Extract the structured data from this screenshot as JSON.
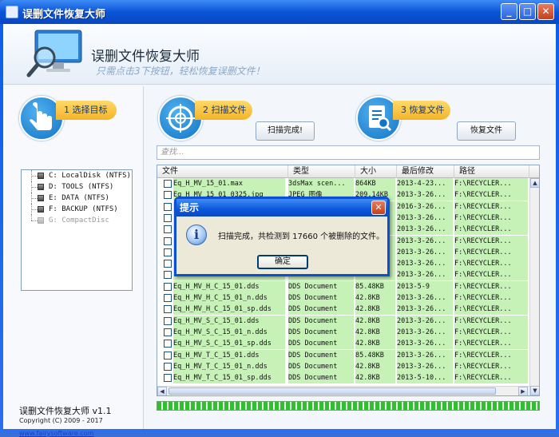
{
  "window": {
    "title": "误删文件恢复大师"
  },
  "header": {
    "app_name": "误删文件恢复大师",
    "slogan": "只需点击3下按钮，轻松恢复误删文件！"
  },
  "steps": {
    "step1": "1 选择目标",
    "step2": "2 扫描文件",
    "step3": "3 恢复文件",
    "scan_button": "扫描完成!",
    "recover_button": "恢复文件"
  },
  "drives": [
    {
      "label": "C: LocalDisk (NTFS)",
      "enabled": true
    },
    {
      "label": "D: TOOLS (NTFS)",
      "enabled": true
    },
    {
      "label": "E: DATA (NTFS)",
      "enabled": true
    },
    {
      "label": "F: BACKUP (NTFS)",
      "enabled": true
    },
    {
      "label": "G: CompactDisc",
      "enabled": false
    }
  ],
  "footer": {
    "version": "误删文件恢复大师 v1.1",
    "copyright": "Copyright (C) 2009 - 2017",
    "website": "www.fairysoftware.com"
  },
  "search": {
    "placeholder": "查找..."
  },
  "table": {
    "columns": [
      "文件",
      "类型",
      "大小",
      "最后修改",
      "路径"
    ],
    "rows": [
      [
        "Eq_H_MV_15_01.max",
        "3dsMax scen...",
        "864KB",
        "2013-4-23...",
        "F:\\RECYCLER..."
      ],
      [
        "Eq_H_MV_15_01_0325.jpg",
        "JPEG 图像",
        "209.14KB",
        "2013-3-26...",
        "F:\\RECYCLER..."
      ],
      [
        "",
        "",
        "",
        "2016-3-26...",
        "F:\\RECYCLER..."
      ],
      [
        "",
        "",
        "",
        "2013-3-26...",
        "F:\\RECYCLER..."
      ],
      [
        "",
        "",
        "",
        "2013-3-26...",
        "F:\\RECYCLER..."
      ],
      [
        "",
        "",
        "",
        "2013-3-26...",
        "F:\\RECYCLER..."
      ],
      [
        "",
        "",
        "",
        "2013-3-26...",
        "F:\\RECYCLER..."
      ],
      [
        "",
        "",
        "",
        "2013-3-26...",
        "F:\\RECYCLER..."
      ],
      [
        "",
        "",
        "",
        "2013-3-26...",
        "F:\\RECYCLER..."
      ],
      [
        "Eq_H_MV_H_C_15_01.dds",
        "DDS Document",
        "85.48KB",
        "2013-5-9",
        "F:\\RECYCLER..."
      ],
      [
        "Eq_H_MV_H_C_15_01_n.dds",
        "DDS Document",
        "42.8KB",
        "2013-3-26...",
        "F:\\RECYCLER..."
      ],
      [
        "Eq_H_MV_H_C_15_01_sp.dds",
        "DDS Document",
        "42.8KB",
        "2013-3-26...",
        "F:\\RECYCLER..."
      ],
      [
        "Eq_H_MV_S_C_15_01.dds",
        "DDS Document",
        "42.8KB",
        "2013-3-26...",
        "F:\\RECYCLER..."
      ],
      [
        "Eq_H_MV_S_C_15_01_n.dds",
        "DDS Document",
        "42.8KB",
        "2013-3-26...",
        "F:\\RECYCLER..."
      ],
      [
        "Eq_H_MV_S_C_15_01_sp.dds",
        "DDS Document",
        "42.8KB",
        "2013-3-26...",
        "F:\\RECYCLER..."
      ],
      [
        "Eq_H_MV_T_C_15_01.dds",
        "DDS Document",
        "85.48KB",
        "2013-3-26...",
        "F:\\RECYCLER..."
      ],
      [
        "Eq_H_MV_T_C_15_01_n.dds",
        "DDS Document",
        "42.8KB",
        "2013-3-26...",
        "F:\\RECYCLER..."
      ],
      [
        "Eq_H_MV_T_C_15_01_sp.dds",
        "DDS Document",
        "42.8KB",
        "2013-5-10...",
        "F:\\RECYCLER..."
      ]
    ]
  },
  "progress": {
    "percent": 100
  },
  "dialog": {
    "title": "提示",
    "message": "扫描完成，共检测到 17660 个被删除的文件。",
    "ok": "确定"
  },
  "colors": {
    "titlebar": "#0b55d8",
    "row_highlight": "#c6f2b8",
    "step_tab": "#f4b428",
    "progress": "#2fbf2f"
  }
}
